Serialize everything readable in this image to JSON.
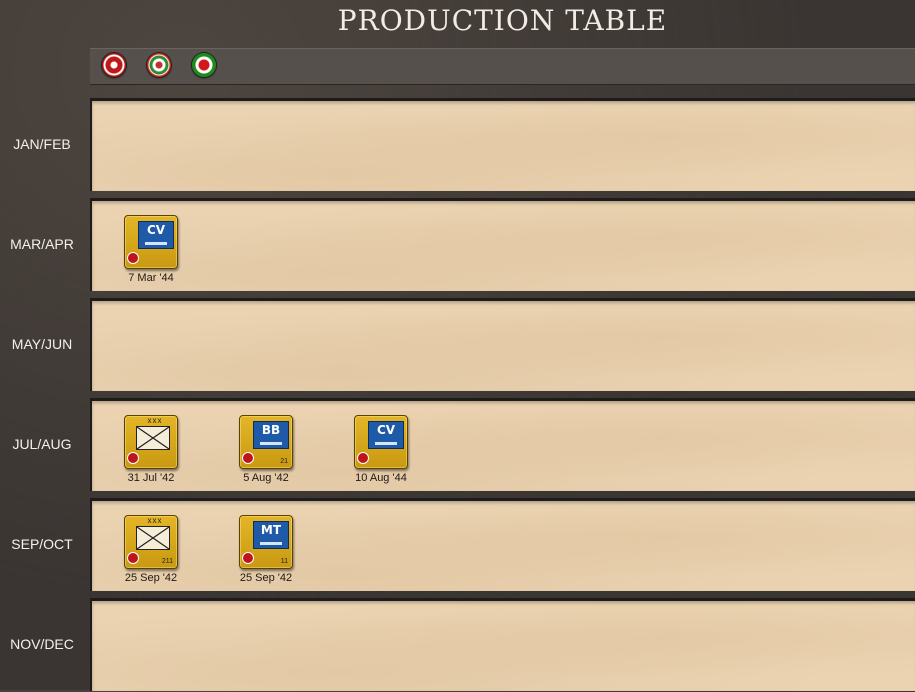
{
  "title": "PRODUCTION TABLE",
  "factions": [
    {
      "name": "germany-roundel-icon"
    },
    {
      "name": "italy-roundel-icon"
    },
    {
      "name": "japan-roundel-icon"
    }
  ],
  "rows": [
    {
      "label": "JAN/FEB",
      "units": []
    },
    {
      "label": "MAR/APR",
      "units": [
        {
          "type": "CV",
          "size": "",
          "id": "",
          "date": "7 Mar '44"
        }
      ]
    },
    {
      "label": "MAY/JUN",
      "units": []
    },
    {
      "label": "JUL/AUG",
      "units": [
        {
          "type": "army",
          "size": "xxx",
          "id": "",
          "date": "31 Jul '42"
        },
        {
          "type": "BB",
          "size": "",
          "id": "21",
          "date": "5 Aug '42"
        },
        {
          "type": "CV",
          "size": "",
          "id": "",
          "date": "10 Aug '44"
        }
      ]
    },
    {
      "label": "SEP/OCT",
      "units": [
        {
          "type": "army",
          "size": "xxx",
          "id": "211",
          "date": "25 Sep '42"
        },
        {
          "type": "MT",
          "size": "",
          "id": "11",
          "date": "25 Sep '42"
        }
      ]
    },
    {
      "label": "NOV/DEC",
      "units": []
    }
  ]
}
